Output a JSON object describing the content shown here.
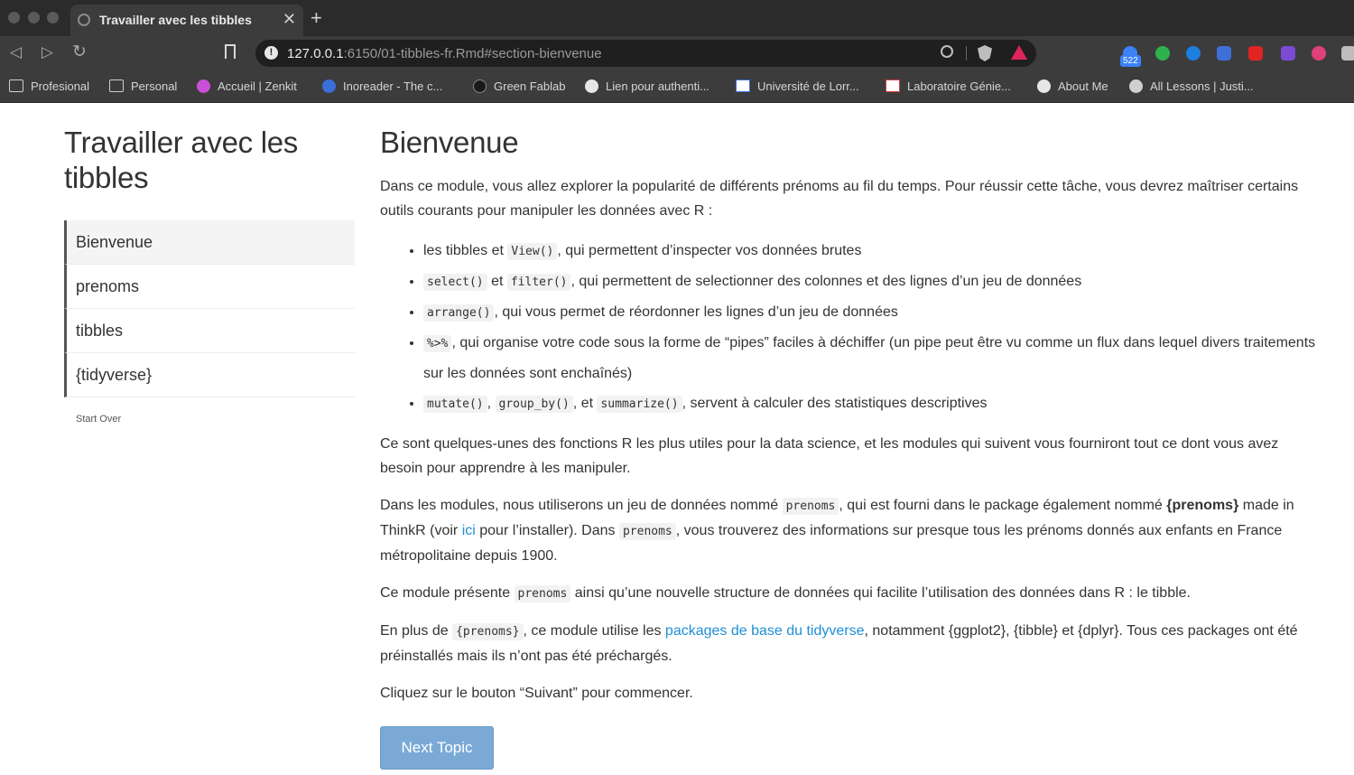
{
  "browser": {
    "tab_title": "Travailler avec les tibbles",
    "tab_close": "✕",
    "new_tab": "+",
    "url_host": "127.0.0.1",
    "url_rest": ":6150/01-tibbles-fr.Rmd#section-bienvenue",
    "ext_badge": "522",
    "bookmarks": [
      {
        "label": "Profesional",
        "icon": "folder-icon"
      },
      {
        "label": "Personal",
        "icon": "folder-icon"
      },
      {
        "label": "Accueil | Zenkit",
        "icon": "zenkit-icon"
      },
      {
        "label": "Inoreader - The c...",
        "icon": "inoreader-icon"
      },
      {
        "label": "Green Fablab",
        "icon": "fablab-icon"
      },
      {
        "label": "Lien pour authenti...",
        "icon": "globe-icon"
      },
      {
        "label": "Université de Lorr...",
        "icon": "chart-icon"
      },
      {
        "label": "Laboratoire Génie...",
        "icon": "lab-icon"
      },
      {
        "label": "About Me",
        "icon": "globe-icon"
      },
      {
        "label": "All Lessons | Justi...",
        "icon": "lessons-icon"
      }
    ]
  },
  "sidebar": {
    "title": "Travailler avec les tibbles",
    "items": [
      "Bienvenue",
      "prenoms",
      "tibbles",
      "{tidyverse}"
    ],
    "start_over": "Start Over"
  },
  "main": {
    "heading": "Bienvenue",
    "intro": "Dans ce module, vous allez explorer la popularité de différents prénoms au fil du temps. Pour réussir cette tâche, vous devrez maîtriser certains outils courants pour manipuler les données avec R :",
    "bullets": [
      {
        "code1": "View()",
        "text1": "les tibbles et ",
        "text2": ", qui permettent d’inspecter vos données brutes"
      },
      {
        "code1": "select()",
        "mid": " et ",
        "code2": "filter()",
        "text2": ", qui permettent de selectionner des colonnes et des lignes d’un jeu de données"
      },
      {
        "code1": "arrange()",
        "text2": ", qui vous permet de réordonner les lignes d’un jeu de données"
      },
      {
        "code1": "%>%",
        "text2": ", qui organise votre code sous la forme de “pipes” faciles à déchiffer (un pipe peut être vu comme un flux dans lequel divers traitements sur les données sont enchaînés)"
      },
      {
        "code1": "mutate()",
        "sep1": ", ",
        "code2": "group_by()",
        "sep2": ", et ",
        "code3": "summarize()",
        "text2": ", servent à calculer des statistiques descriptives"
      }
    ],
    "p2": "Ce sont quelques-unes des fonctions R les plus utiles pour la data science, et les modules qui suivent vous fourniront tout ce dont vous avez besoin pour apprendre à les manipuler.",
    "p3": {
      "a": "Dans les modules, nous utiliserons un jeu de données nommé ",
      "code": "prenoms",
      "b": ", qui est fourni dans le package également nommé ",
      "bold": "{prenoms}",
      "c": " made in ThinkR (voir ",
      "link": "ici",
      "d": " pour l’installer). Dans ",
      "code2": "prenoms",
      "e": ", vous trouverez des informations sur presque tous les prénoms donnés aux enfants en France métropolitaine depuis 1900."
    },
    "p4": {
      "a": "Ce module présente ",
      "code": "prenoms",
      "b": " ainsi qu’une nouvelle structure de données qui facilite l’utilisation des données dans R : le tibble."
    },
    "p5": {
      "a": "En plus de ",
      "code": "{prenoms}",
      "b": ", ce module utilise les ",
      "link": "packages de base du tidyverse",
      "c": ", notamment {ggplot2}, {tibble} et {dplyr}. Tous ces packages ont été préinstallés mais ils n’ont pas été préchargés."
    },
    "p6": "Cliquez sur le bouton “Suivant” pour commencer.",
    "next_button": "Next Topic"
  },
  "colors": {
    "link": "#1f8fd6",
    "button": "#7aa9d6",
    "chrome_dark": "#2b2b2b",
    "chrome_mid": "#3c3c3c"
  }
}
